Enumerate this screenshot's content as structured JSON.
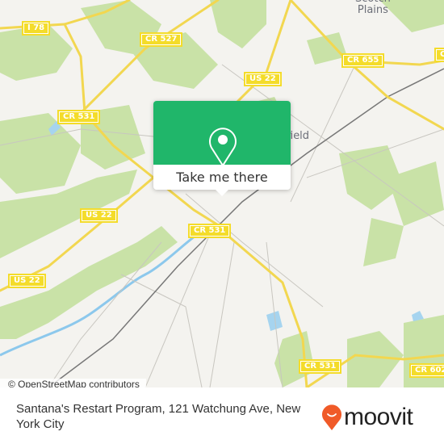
{
  "map": {
    "road_labels": [
      {
        "id": "i78",
        "text": "I 78"
      },
      {
        "id": "cr527",
        "text": "CR 527"
      },
      {
        "id": "us22-top",
        "text": "US 22"
      },
      {
        "id": "cr655",
        "text": "CR 655"
      },
      {
        "id": "cr-edge",
        "text": "C"
      },
      {
        "id": "cr531-left",
        "text": "CR 531"
      },
      {
        "id": "us22-mid",
        "text": "US 22"
      },
      {
        "id": "cr531-center",
        "text": "CR 531"
      },
      {
        "id": "us22-left",
        "text": "US 22"
      },
      {
        "id": "cr531-bottom",
        "text": "CR 531"
      },
      {
        "id": "cr602",
        "text": "CR 602"
      }
    ],
    "towns": {
      "scotch_plains_line1": "Scotch",
      "scotch_plains_line2": "Plains",
      "plainfield_partial": "field"
    },
    "attribution": "© OpenStreetMap contributors"
  },
  "popup": {
    "icon": "map-pin-icon",
    "button_label": "Take me there",
    "color": "#20b66a"
  },
  "footer": {
    "address": "Santana's Restart Program, 121 Watchung Ave, New York City",
    "brand": "moovit",
    "brand_icon": "moovit-pin-icon",
    "brand_color": "#f05a28"
  }
}
